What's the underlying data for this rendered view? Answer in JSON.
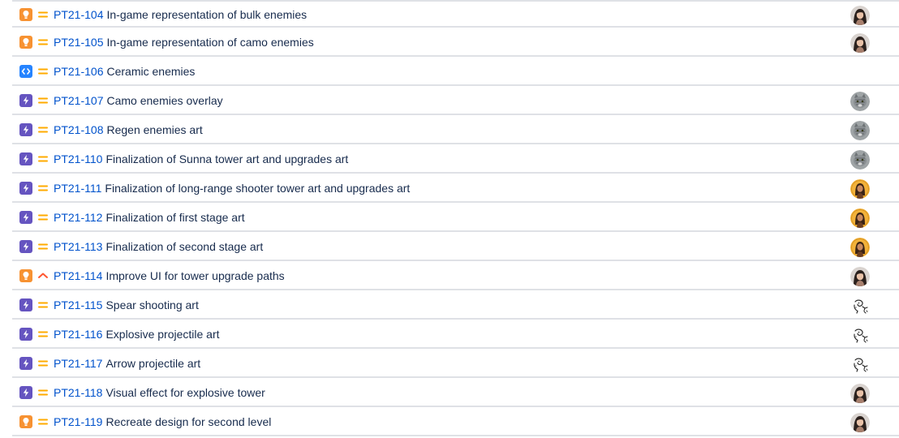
{
  "colors": {
    "idea": "#f79232",
    "task_code": "#2684ff",
    "epic": "#6554c0",
    "priority_medium": "#ffab00",
    "priority_high": "#ff5630",
    "key_link": "#0052cc"
  },
  "issues": [
    {
      "key": "PT21-104",
      "summary": "In-game representation of bulk enemies",
      "type": "idea-icon",
      "priority": "medium",
      "avatar": "avatar-woman-dark-hair"
    },
    {
      "key": "PT21-105",
      "summary": "In-game representation of camo enemies",
      "type": "idea-icon",
      "priority": "medium",
      "avatar": "avatar-woman-dark-hair"
    },
    {
      "key": "PT21-106",
      "summary": "Ceramic enemies",
      "type": "code-icon",
      "priority": "medium",
      "avatar": ""
    },
    {
      "key": "PT21-107",
      "summary": "Camo enemies overlay",
      "type": "bolt-icon",
      "priority": "medium",
      "avatar": "avatar-cat"
    },
    {
      "key": "PT21-108",
      "summary": "Regen enemies art",
      "type": "bolt-icon",
      "priority": "medium",
      "avatar": "avatar-cat"
    },
    {
      "key": "PT21-110",
      "summary": "Finalization of Sunna tower art and upgrades art",
      "type": "bolt-icon",
      "priority": "medium",
      "avatar": "avatar-cat"
    },
    {
      "key": "PT21-111",
      "summary": "Finalization of long-range shooter tower art and upgrades art",
      "type": "bolt-icon",
      "priority": "medium",
      "avatar": "avatar-yellow-portrait"
    },
    {
      "key": "PT21-112",
      "summary": "Finalization of first stage art",
      "type": "bolt-icon",
      "priority": "medium",
      "avatar": "avatar-yellow-portrait"
    },
    {
      "key": "PT21-113",
      "summary": "Finalization of second stage art",
      "type": "bolt-icon",
      "priority": "medium",
      "avatar": "avatar-yellow-portrait"
    },
    {
      "key": "PT21-114",
      "summary": "Improve UI for tower upgrade paths",
      "type": "idea-icon",
      "priority": "high",
      "avatar": "avatar-woman-dark-hair"
    },
    {
      "key": "PT21-115",
      "summary": "Spear shooting art",
      "type": "bolt-icon",
      "priority": "medium",
      "avatar": "avatar-sketch"
    },
    {
      "key": "PT21-116",
      "summary": "Explosive projectile art",
      "type": "bolt-icon",
      "priority": "medium",
      "avatar": "avatar-sketch"
    },
    {
      "key": "PT21-117",
      "summary": "Arrow projectile art",
      "type": "bolt-icon",
      "priority": "medium",
      "avatar": "avatar-sketch"
    },
    {
      "key": "PT21-118",
      "summary": "Visual effect for explosive tower",
      "type": "bolt-icon",
      "priority": "medium",
      "avatar": "avatar-woman-dark-hair"
    },
    {
      "key": "PT21-119",
      "summary": "Recreate design for second level",
      "type": "idea-icon",
      "priority": "medium",
      "avatar": "avatar-woman-dark-hair"
    }
  ]
}
